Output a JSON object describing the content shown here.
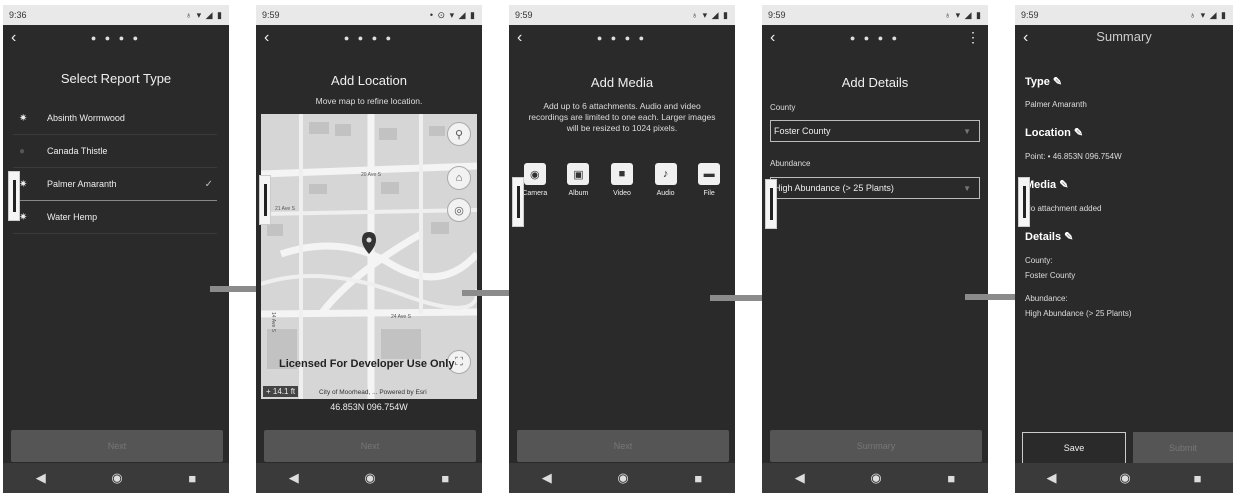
{
  "screens": [
    {
      "status_time": "9:36",
      "status_icons": "♁ ▾ ◢ ▮",
      "title": "Select Report Type",
      "items": [
        {
          "label": "Absinth Wormwood",
          "icon": "weed-icon"
        },
        {
          "label": "Canada Thistle",
          "icon": "dot-icon"
        },
        {
          "label": "Palmer Amaranth",
          "icon": "weed-icon",
          "checked": true
        },
        {
          "label": "Water Hemp",
          "icon": "weed-icon"
        }
      ],
      "next_label": "Next"
    },
    {
      "status_time": "9:59",
      "status_icons": "• ⊙ ▾ ◢ ▮",
      "title": "Add Location",
      "subtitle": "Move map to refine location.",
      "map": {
        "streets": [
          "20 Ave S",
          "21 Ave S",
          "24 Ave S",
          "14 Ave S"
        ],
        "license_text": "Licensed For Developer Use Only",
        "scale": "+ 14.1 ft",
        "credit": "City of Moorhead, ...   Powered by Esri"
      },
      "coordinates": "46.853N 096.754W",
      "next_label": "Next"
    },
    {
      "status_time": "9:59",
      "status_icons": "♁ ▾ ◢ ▮",
      "title": "Add Media",
      "subtitle": "Add up to 6 attachments. Audio and video recordings are limited to one each. Larger images will be resized to 1024 pixels.",
      "media_buttons": [
        "Camera",
        "Album",
        "Video",
        "Audio",
        "File"
      ],
      "next_label": "Next"
    },
    {
      "status_time": "9:59",
      "status_icons": "♁ ▾ ◢ ▮",
      "title": "Add Details",
      "county_label": "County",
      "county_value": "Foster County",
      "abundance_label": "Abundance",
      "abundance_value": "High Abundance (> 25 Plants)",
      "summary_label": "Summary"
    },
    {
      "status_time": "9:59",
      "status_icons": "♁ ▾ ◢ ▮",
      "title": "Summary",
      "type_heading": "Type",
      "type_value": "Palmer Amaranth",
      "location_heading": "Location",
      "location_value": "Point: • 46.853N 096.754W",
      "media_heading": "Media",
      "media_value": "No attachment added",
      "details_heading": "Details",
      "county_label": "County:",
      "county_value": "Foster County",
      "abundance_label": "Abundance:",
      "abundance_value": "High Abundance (> 25 Plants)",
      "save_label": "Save",
      "submit_label": "Submit"
    }
  ],
  "nav": {
    "back": "◀",
    "home": "◉",
    "recents": "■"
  },
  "colors": {
    "screen_bg": "#2a2a2a",
    "button_disabled": "#555555",
    "arrow": "#8b8b8b"
  }
}
